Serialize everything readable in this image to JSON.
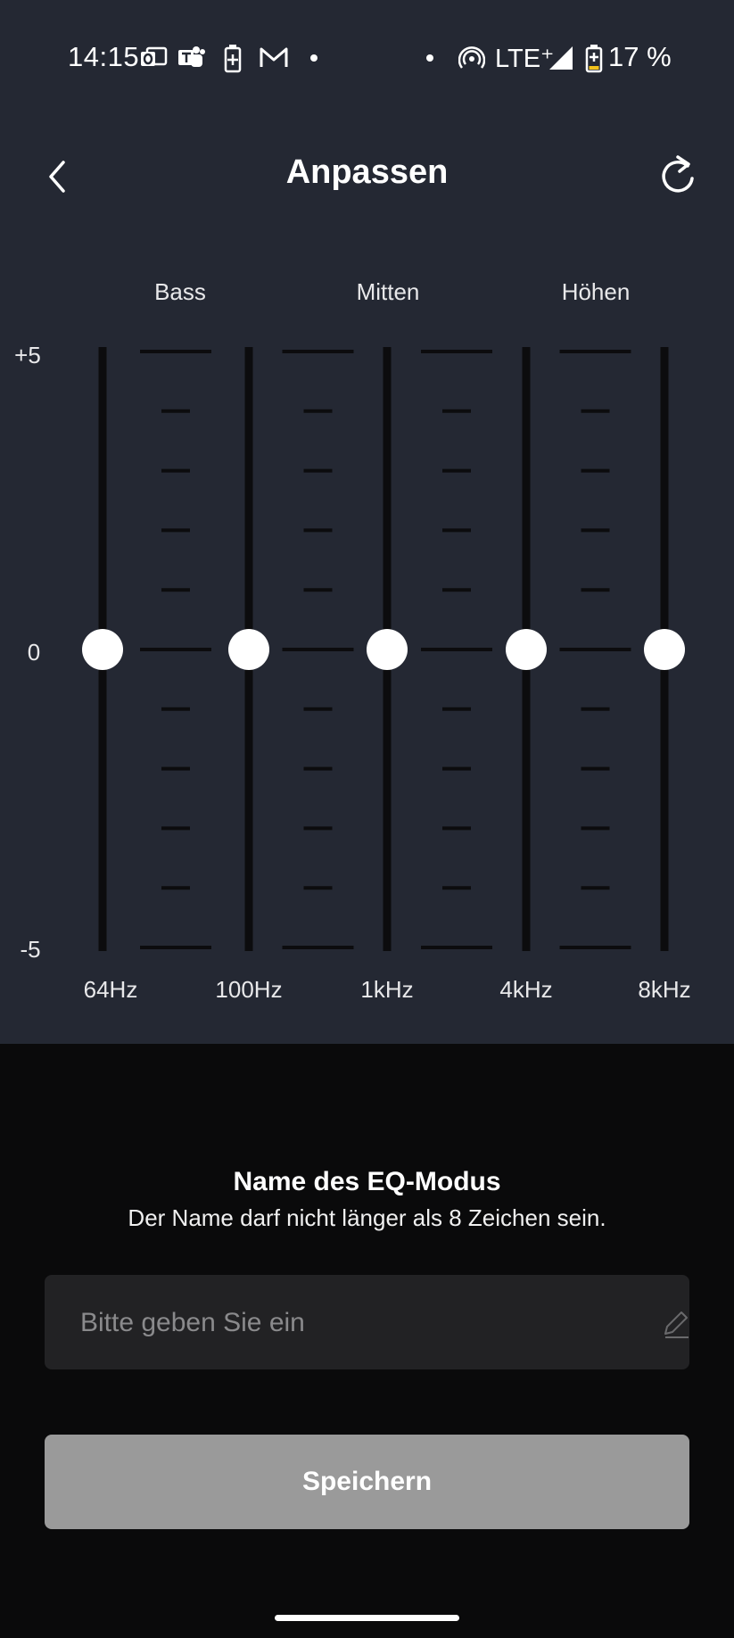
{
  "status_bar": {
    "time": "14:15",
    "network": "LTE⁺",
    "battery": "17 %",
    "icons": [
      "outlook-icon",
      "teams-icon",
      "battery-saver-icon",
      "gmail-icon",
      "dot-icon",
      "dot-icon",
      "hotspot-icon",
      "signal-icon",
      "battery-charging-icon"
    ]
  },
  "header": {
    "title": "Anpassen",
    "back_icon": "chevron-left-icon",
    "reset_icon": "refresh-icon"
  },
  "equalizer": {
    "band_groups": [
      "Bass",
      "Mitten",
      "Höhen"
    ],
    "scale_top": "+5",
    "scale_mid": "0",
    "scale_bottom": "-5",
    "range": [
      -5,
      5
    ],
    "bands": [
      {
        "label": "64Hz",
        "value": 0
      },
      {
        "label": "100Hz",
        "value": 0
      },
      {
        "label": "1kHz",
        "value": 0
      },
      {
        "label": "4kHz",
        "value": 0
      },
      {
        "label": "8kHz",
        "value": 0
      }
    ]
  },
  "name_section": {
    "title": "Name des EQ-Modus",
    "subtitle": "Der Name darf nicht länger als 8 Zeichen sein.",
    "input_value": "",
    "input_placeholder": "Bitte geben Sie ein",
    "edit_icon": "pencil-icon"
  },
  "save_label": "Speichern",
  "colors": {
    "top_background": "#242833",
    "bottom_background": "#0a0a0b",
    "track": "#0c0c0e",
    "thumb": "#ffffff",
    "save_button": "#9a9a9a"
  }
}
